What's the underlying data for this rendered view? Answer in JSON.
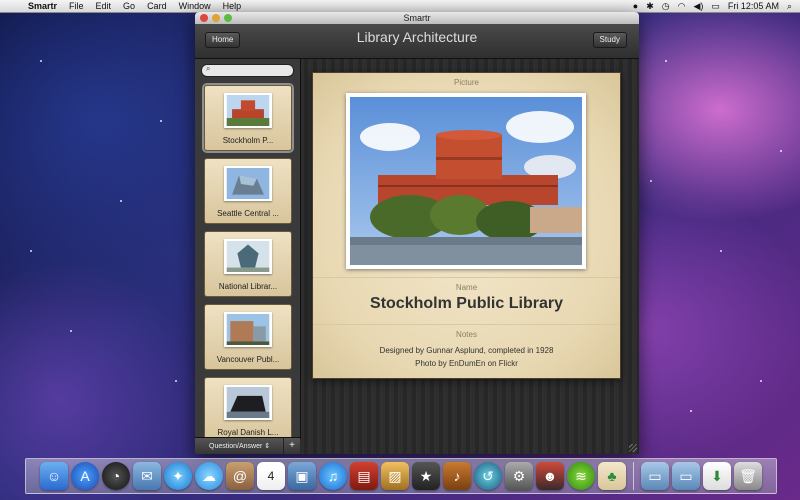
{
  "menubar": {
    "app_name": "Smartr",
    "items": [
      "File",
      "Edit",
      "Go",
      "Card",
      "Window",
      "Help"
    ],
    "clock": "Fri 12:05 AM"
  },
  "window": {
    "title": "Smartr",
    "toolbar": {
      "home_label": "Home",
      "deck_title": "Library Architecture",
      "study_label": "Study"
    },
    "sidebar": {
      "search_placeholder": "",
      "cards": [
        {
          "label": "Stockholm P...",
          "selected": true
        },
        {
          "label": "Seattle Central ...",
          "selected": false
        },
        {
          "label": "National Librar...",
          "selected": false
        },
        {
          "label": "Vancouver Publ...",
          "selected": false
        },
        {
          "label": "Royal Danish L...",
          "selected": false
        }
      ],
      "mode_label": "Question/Answer ⇕",
      "add_label": "+"
    },
    "card_detail": {
      "picture_label": "Picture",
      "name_label": "Name",
      "name_value": "Stockholm Public Library",
      "notes_label": "Notes",
      "notes_line1": "Designed by Gunnar Asplund, completed in 1928",
      "notes_line2": "Photo by EnDumEn on Flickr"
    }
  },
  "dock": {
    "icons": [
      "finder-icon",
      "app-store-icon",
      "dashboard-icon",
      "mail-icon",
      "safari-icon",
      "ichat-icon",
      "address-book-icon",
      "ical-icon",
      "iphoto-icon",
      "itunes-icon",
      "photo-booth-icon",
      "preview-icon",
      "imovie-icon",
      "garageband-icon",
      "time-machine-icon",
      "system-preferences-icon",
      "game-icon",
      "spotify-icon",
      "smartr-icon",
      "applications-folder-icon",
      "documents-folder-icon",
      "downloads-stack-icon",
      "trash-icon"
    ],
    "ical_day": "4"
  },
  "colors": {
    "card_bg": "#e8d8b2",
    "window_dark": "#2b2b2b",
    "accent_close": "#e0443e"
  }
}
